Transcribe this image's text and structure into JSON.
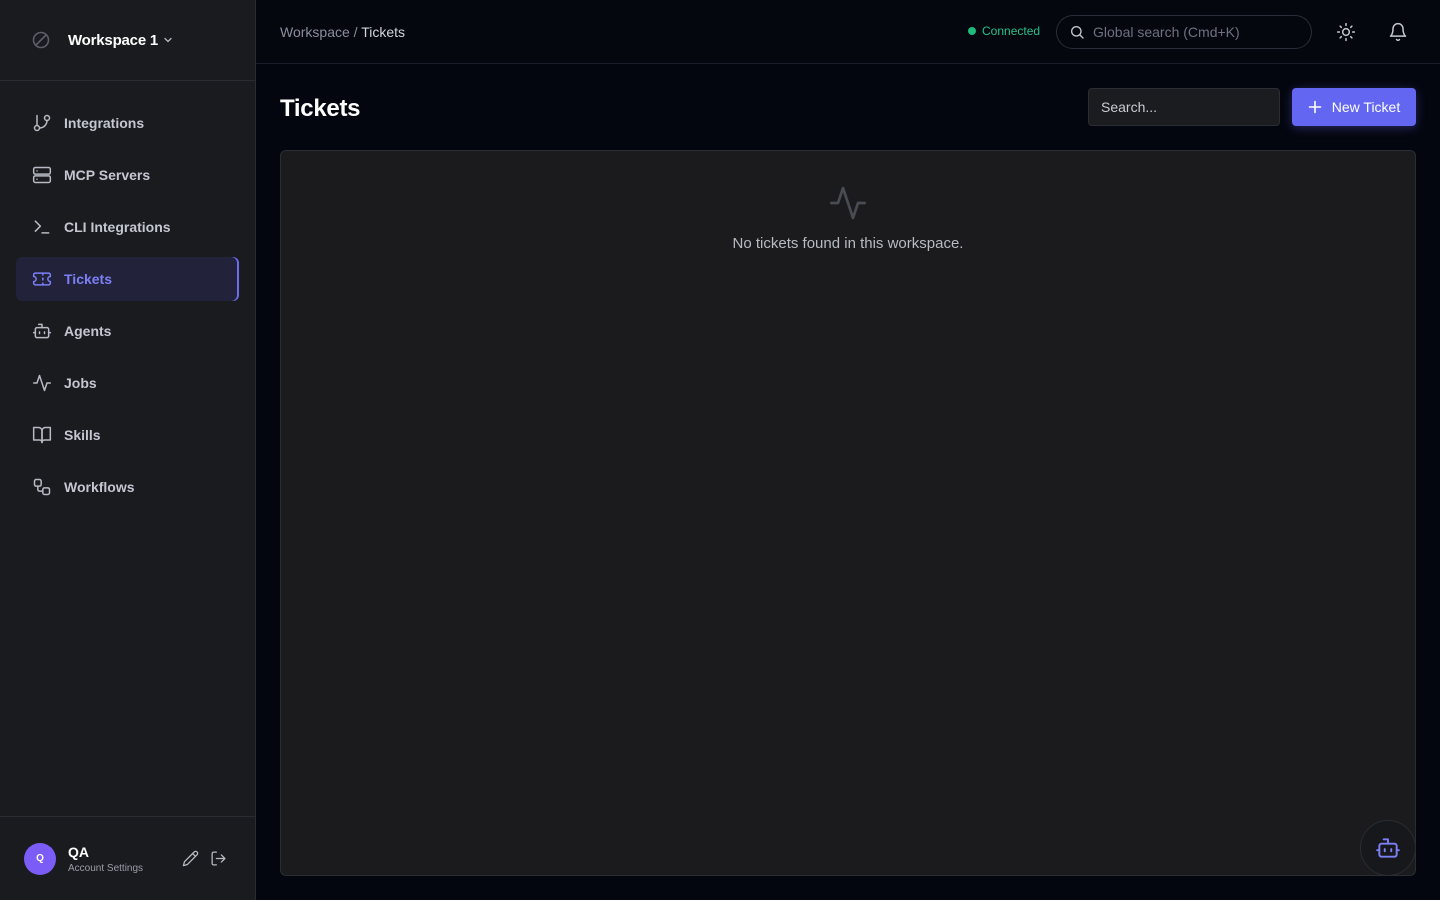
{
  "workspace": {
    "name": "Workspace 1",
    "logo_icon": "slash-circle-icon"
  },
  "sidebar": {
    "items": [
      {
        "label": "Integrations",
        "icon": "git-branch-icon",
        "active": false
      },
      {
        "label": "MCP Servers",
        "icon": "server-icon",
        "active": false
      },
      {
        "label": "CLI Integrations",
        "icon": "terminal-icon",
        "active": false
      },
      {
        "label": "Tickets",
        "icon": "ticket-icon",
        "active": true
      },
      {
        "label": "Agents",
        "icon": "bot-icon",
        "active": false
      },
      {
        "label": "Jobs",
        "icon": "activity-icon",
        "active": false
      },
      {
        "label": "Skills",
        "icon": "book-open-icon",
        "active": false
      },
      {
        "label": "Workflows",
        "icon": "workflow-icon",
        "active": false
      }
    ]
  },
  "user": {
    "initial": "Q",
    "name": "QA",
    "subtitle": "Account Settings"
  },
  "topbar": {
    "breadcrumb_root": "Workspace",
    "breadcrumb_sep": "/",
    "breadcrumb_current": "Tickets",
    "status": "Connected",
    "global_search_placeholder": "Global search (Cmd+K)"
  },
  "main": {
    "title": "Tickets",
    "search_placeholder": "Search...",
    "new_ticket_label": "New Ticket",
    "empty_text": "No tickets found in this workspace."
  },
  "colors": {
    "accent": "#6366f1",
    "status_ok": "#1fb97b",
    "avatar": "#7c5cf6"
  }
}
